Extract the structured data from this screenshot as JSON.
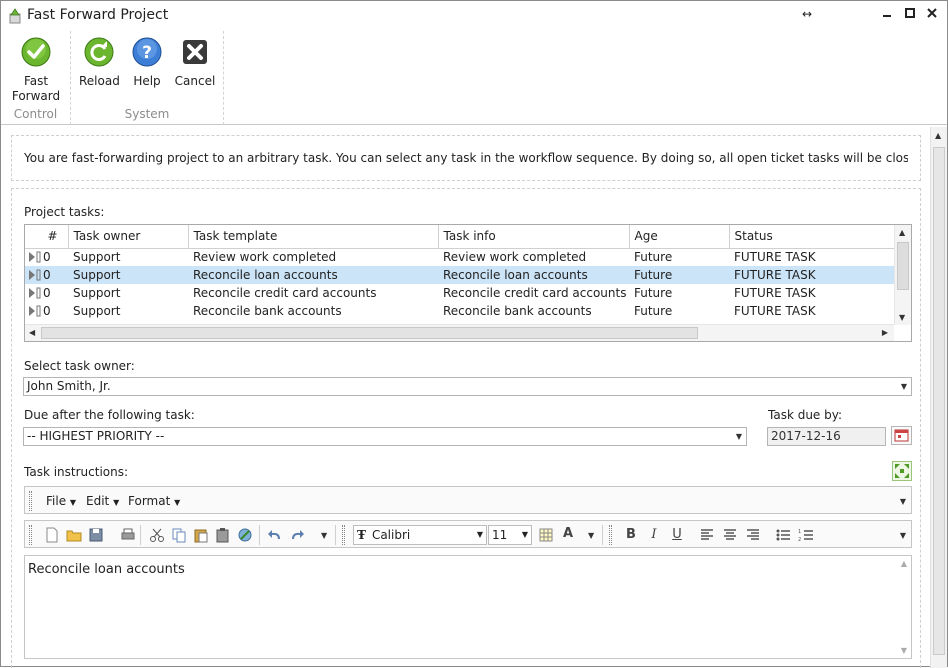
{
  "window": {
    "title": "Fast Forward Project",
    "controls": {
      "resize": "↔",
      "minimize": "—",
      "maximize": "□",
      "close": "✕"
    }
  },
  "ribbon": {
    "groups": [
      {
        "label": "Control",
        "buttons": [
          {
            "label_line1": "Fast",
            "label_line2": "Forward",
            "icon": "check-circle-icon",
            "color": "#5aa02c"
          }
        ]
      },
      {
        "label": "System",
        "buttons": [
          {
            "label": "Reload",
            "icon": "reload-icon",
            "color": "#5aa02c"
          },
          {
            "label": "Help",
            "icon": "help-icon",
            "color": "#3a74c8"
          },
          {
            "label": "Cancel",
            "icon": "cancel-icon",
            "color": "#333333"
          }
        ]
      }
    ]
  },
  "info_text": "You are fast-forwarding project to an arbitrary task. You can select any task in the workflow sequence. By doing so, all open ticket tasks will be closed and the",
  "project_tasks": {
    "label": "Project tasks:",
    "columns": [
      "#",
      "Task owner",
      "Task template",
      "Task info",
      "Age",
      "Status"
    ],
    "rows": [
      {
        "num": "0",
        "owner": "Support",
        "template": "Review work completed",
        "info": "Review work completed",
        "age": "Future",
        "status": "FUTURE TASK",
        "selected": false
      },
      {
        "num": "0",
        "owner": "Support",
        "template": "Reconcile loan accounts",
        "info": "Reconcile loan accounts",
        "age": "Future",
        "status": "FUTURE TASK",
        "selected": true
      },
      {
        "num": "0",
        "owner": "Support",
        "template": "Reconcile credit card accounts",
        "info": "Reconcile credit card accounts",
        "age": "Future",
        "status": "FUTURE TASK",
        "selected": false
      },
      {
        "num": "0",
        "owner": "Support",
        "template": "Reconcile bank accounts",
        "info": "Reconcile bank accounts",
        "age": "Future",
        "status": "FUTURE TASK",
        "selected": false
      }
    ]
  },
  "task_owner": {
    "label": "Select task owner:",
    "value": "John Smith, Jr."
  },
  "due_after": {
    "label": "Due after the following task:",
    "value": "-- HIGHEST PRIORITY --"
  },
  "task_due": {
    "label": "Task due by:",
    "value": "2017-12-16"
  },
  "instructions": {
    "label": "Task instructions:",
    "menu": [
      "File",
      "Edit",
      "Format"
    ],
    "font": "Calibri",
    "font_size": "11",
    "text": "Reconcile loan accounts"
  },
  "colors": {
    "selected_row": "#cce4f7",
    "accent_green": "#5aa02c",
    "accent_blue": "#3a74c8"
  }
}
